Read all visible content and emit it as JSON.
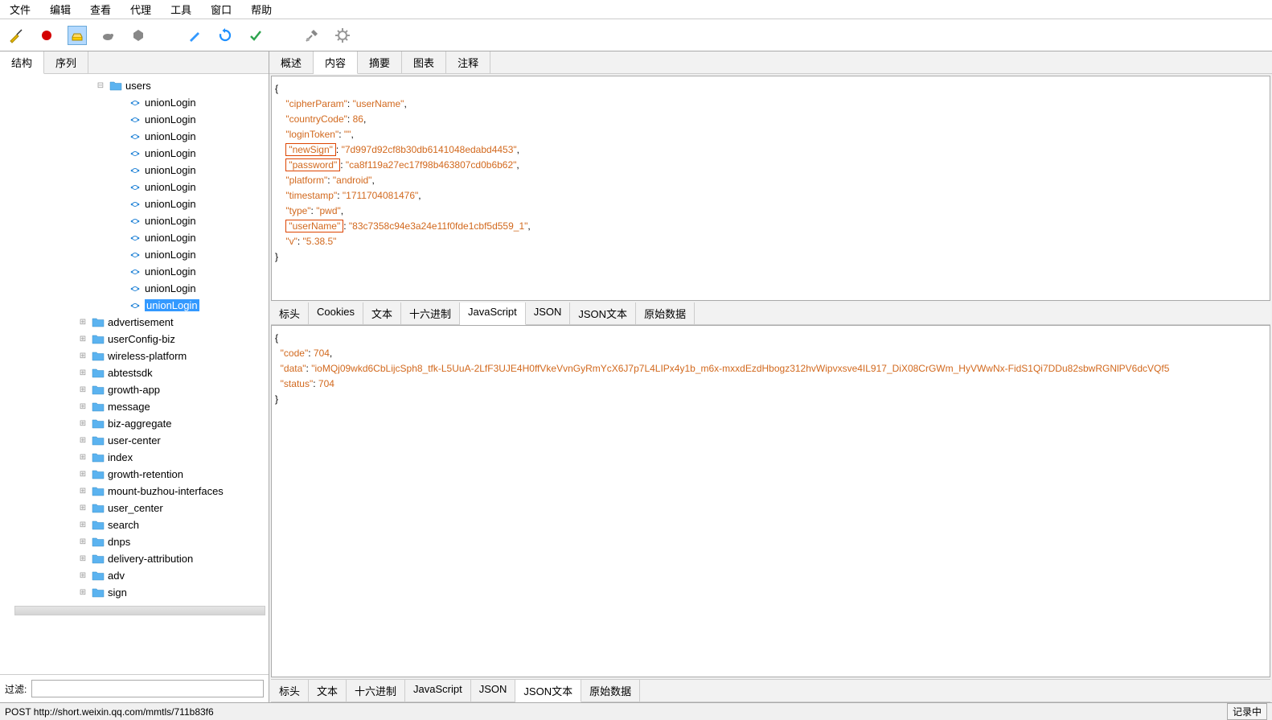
{
  "menu": {
    "items": [
      "文件",
      "编辑",
      "查看",
      "代理",
      "工具",
      "窗口",
      "帮助"
    ]
  },
  "left_tabs": {
    "items": [
      "结构",
      "序列"
    ],
    "active": 0
  },
  "tree": {
    "root": {
      "exp": "⊟",
      "label": "users"
    },
    "requests": [
      "unionLogin",
      "unionLogin",
      "unionLogin",
      "unionLogin",
      "unionLogin",
      "unionLogin",
      "unionLogin",
      "unionLogin",
      "unionLogin",
      "unionLogin",
      "unionLogin",
      "unionLogin",
      "unionLogin"
    ],
    "selected_index": 12,
    "folders": [
      {
        "label": "advertisement"
      },
      {
        "label": "userConfig-biz"
      },
      {
        "label": "wireless-platform"
      },
      {
        "label": "abtestsdk"
      },
      {
        "label": "growth-app"
      },
      {
        "label": "message"
      },
      {
        "label": "biz-aggregate"
      },
      {
        "label": "user-center"
      },
      {
        "label": "index"
      },
      {
        "label": "growth-retention"
      },
      {
        "label": "mount-buzhou-interfaces"
      },
      {
        "label": "user_center"
      },
      {
        "label": "search"
      },
      {
        "label": "dnps"
      },
      {
        "label": "delivery-attribution"
      },
      {
        "label": "adv"
      },
      {
        "label": "sign"
      }
    ]
  },
  "filter_label": "过滤:",
  "top_tabs": {
    "items": [
      "概述",
      "内容",
      "摘要",
      "图表",
      "注释"
    ],
    "active": 1
  },
  "json_upper": {
    "lines": [
      {
        "t": "{"
      },
      {
        "k": "\"cipherParam\"",
        "v": "\"userName\"",
        "comma": true
      },
      {
        "k": "\"countryCode\"",
        "v": "86",
        "num": true,
        "comma": true
      },
      {
        "k": "\"loginToken\"",
        "v": "\"\"",
        "comma": true
      },
      {
        "k": "\"newSign\"",
        "v": "\"7d997d92cf8b30db6141048edabd4453\"",
        "box": true,
        "comma": true
      },
      {
        "k": "\"password\"",
        "v": "\"ca8f119a27ec17f98b463807cd0b6b62\"",
        "box": true,
        "comma": true
      },
      {
        "k": "\"platform\"",
        "v": "\"android\"",
        "comma": true
      },
      {
        "k": "\"timestamp\"",
        "v": "\"1711704081476\"",
        "comma": true
      },
      {
        "k": "\"type\"",
        "v": "\"pwd\"",
        "comma": true
      },
      {
        "k": "\"userName\"",
        "v": "\"83c7358c94e3a24e11f0fde1cbf5d559_1\"",
        "box": true,
        "comma": true
      },
      {
        "k": "\"v\"",
        "v": "\"5.38.5\""
      },
      {
        "t": "}"
      }
    ]
  },
  "mid_tabs": {
    "items": [
      "标头",
      "Cookies",
      "文本",
      "十六进制",
      "JavaScript",
      "JSON",
      "JSON文本",
      "原始数据"
    ],
    "active": 4
  },
  "json_lower": {
    "lines": [
      {
        "t": "{"
      },
      {
        "k": "\"code\"",
        "v": "704",
        "num": true,
        "comma": true
      },
      {
        "k": "\"data\"",
        "v": "\"ioMQj09wkd6CbLijcSph8_tfk-L5UuA-2LfF3UJE4H0ffVkeVvnGyRmYcX6J7p7L4LIPx4y1b_m6x-mxxdEzdHbogz312hvWipvxsve4IL917_DiX08CrGWm_HyVWwNx-FidS1Qi7DDu82sbwRGNlPV6dcVQf5",
        "comma": false
      },
      {
        "k": "\"status\"",
        "v": "704",
        "num": true
      },
      {
        "t": "}"
      }
    ]
  },
  "bot_tabs": {
    "items": [
      "标头",
      "文本",
      "十六进制",
      "JavaScript",
      "JSON",
      "JSON文本",
      "原始数据"
    ],
    "active": 5
  },
  "status": {
    "left": "POST http://short.weixin.qq.com/mmtls/711b83f6",
    "right": "记录中"
  }
}
